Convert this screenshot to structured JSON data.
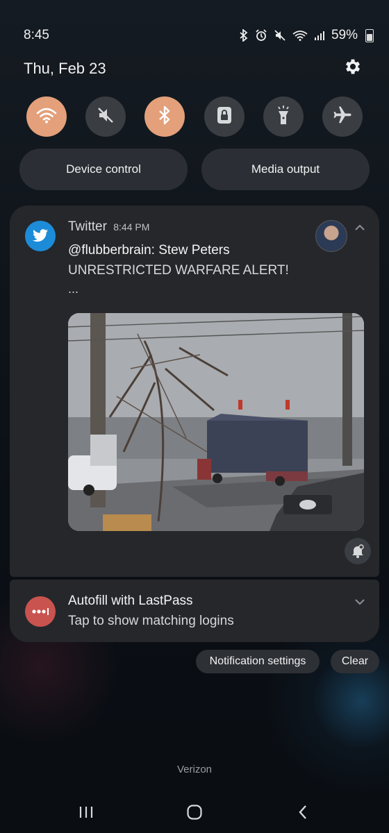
{
  "status": {
    "time": "8:45",
    "battery": "59%"
  },
  "header": {
    "date": "Thu, Feb 23",
    "settings_icon": "gear-icon"
  },
  "quick_settings": [
    {
      "name": "wifi",
      "icon": "wifi-icon",
      "active": true
    },
    {
      "name": "sound",
      "icon": "mute-icon",
      "active": false
    },
    {
      "name": "bluetooth",
      "icon": "bluetooth-icon",
      "active": true
    },
    {
      "name": "rotation-lock",
      "icon": "lock-icon",
      "active": false
    },
    {
      "name": "flashlight",
      "icon": "flashlight-icon",
      "active": false
    },
    {
      "name": "airplane",
      "icon": "airplane-icon",
      "active": false
    }
  ],
  "controls": {
    "device_control": "Device control",
    "media_output": "Media output"
  },
  "notifications": {
    "twitter": {
      "app": "Twitter",
      "time": "8:44 PM",
      "title": "@flubberbrain: Stew Peters",
      "text": "UNRESTRICTED WARFARE ALERT!",
      "more": "..."
    },
    "lastpass": {
      "title": "Autofill with LastPass",
      "subtitle": "Tap to show matching logins"
    }
  },
  "actions": {
    "notification_settings": "Notification settings",
    "clear": "Clear"
  },
  "carrier": "Verizon",
  "colors": {
    "accent_on": "#e3a07a",
    "twitter_blue": "#1d8cd8",
    "lastpass_red": "#c9534f"
  }
}
